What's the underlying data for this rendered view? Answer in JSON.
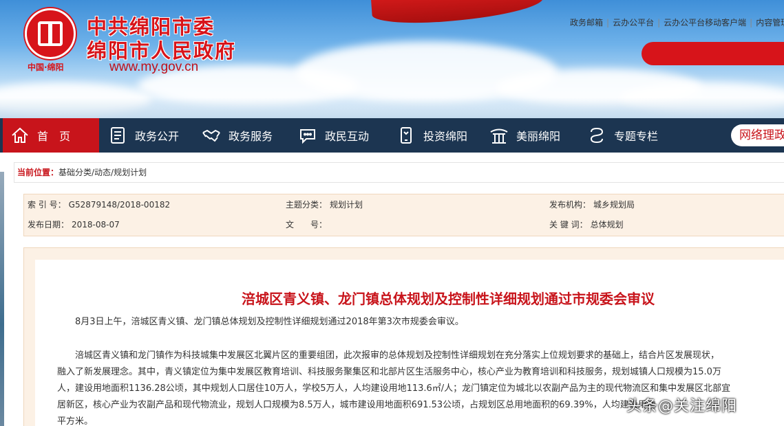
{
  "header": {
    "logo_caption": "中国·绵阳",
    "title_line1": "中共绵阳市委",
    "title_line2": "绵阳市人民政府",
    "url": "www.my.gov.cn",
    "top_links": [
      "政务邮箱",
      "云办公平台",
      "云办公平台移动客户端",
      "内容管理"
    ]
  },
  "nav": {
    "items": [
      {
        "label": "首  页",
        "icon": "home-icon"
      },
      {
        "label": "政务公开",
        "icon": "document-icon"
      },
      {
        "label": "政务服务",
        "icon": "handshake-icon"
      },
      {
        "label": "政民互动",
        "icon": "chat-icon"
      },
      {
        "label": "投资绵阳",
        "icon": "phone-icon"
      },
      {
        "label": "美丽绵阳",
        "icon": "pavilion-icon"
      },
      {
        "label": "专题专栏",
        "icon": "topic-icon"
      }
    ],
    "network_button": "网络理政"
  },
  "breadcrumb": {
    "label": "当前位置：",
    "path": "基础分类/动态/规划计划"
  },
  "meta": {
    "index_label": "索 引 号：",
    "index_value": "G52879148/2018-00182",
    "topic_label": "主题分类：",
    "topic_value": "规划计划",
    "publisher_label": "发布机构：",
    "publisher_value": "城乡规划局",
    "date_label": "发布日期：",
    "date_value": "2018-08-07",
    "docno_label": "文　　号：",
    "docno_value": "",
    "keyword_label": "关 键 词：",
    "keyword_value": "总体规划"
  },
  "article": {
    "headline": "涪城区青义镇、龙门镇总体规划及控制性详细规划通过市规委会审议",
    "para1": "8月3日上午，涪城区青义镇、龙门镇总体规划及控制性详细规划通过2018年第3次市规委会审议。",
    "para2_line1": "涪城区青义镇和龙门镇作为科技城集中发展区北翼片区的重要组团，此次报审的总体规划及控制性详细规划在充分落实上位规划要求的基础上，结合片区发展现状，",
    "para2_line2": "融入了新发展理念。其中，青义镇定位为集中发展区教育培训、科技服务聚集区和北部片区生活服务中心，核心产业为教育培训和科技服务，规划城镇人口规模为15.0万",
    "para2_line3": "人，建设用地面积1136.28公顷，其中规划人口居住10万人，学校5万人，人均建设用地113.6㎡/人；龙门镇定位为城北以农副产品为主的现代物流区和集中发展区北部宜",
    "para2_line4": "居新区，核心产业为农副产品和现代物流业，规划人口规模为8.5万人，城市建设用地面积691.53公顷，占规划区总用地面积的69.39%，人均建设用地",
    "para2_line5": "平方米。"
  },
  "watermark": {
    "text": "头条@关注绵阳"
  }
}
